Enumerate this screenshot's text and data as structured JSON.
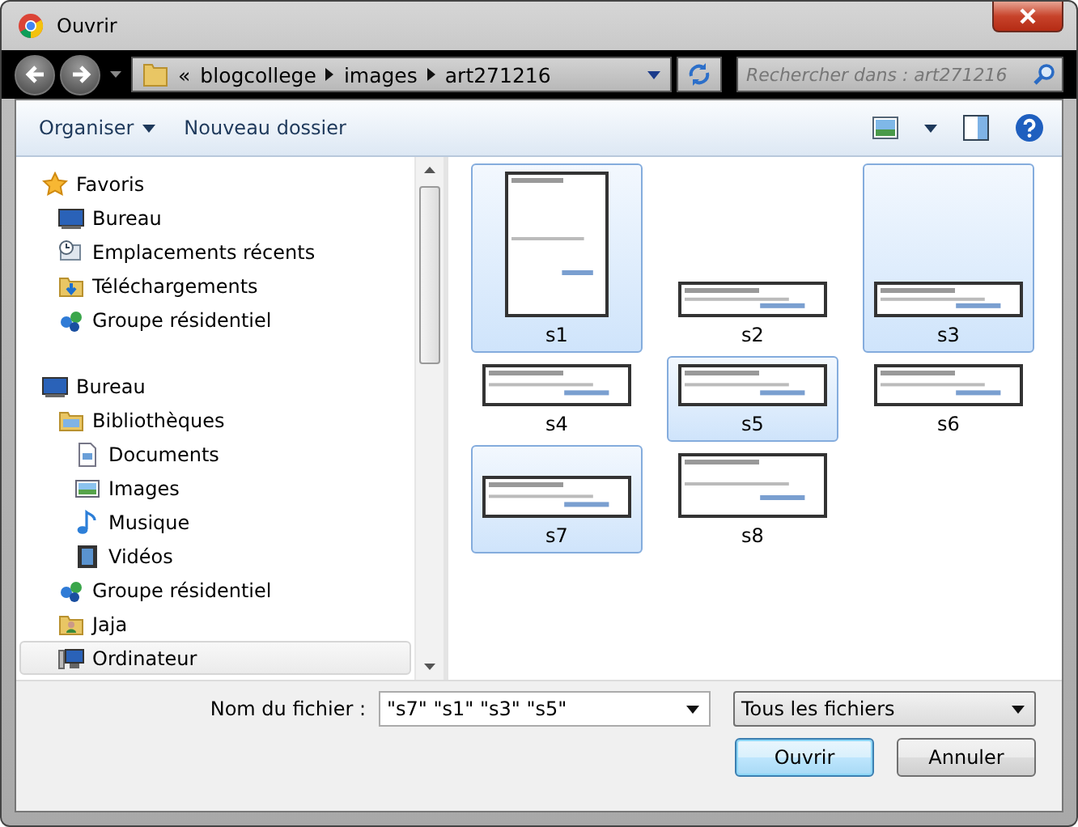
{
  "window": {
    "title": "Ouvrir"
  },
  "address": {
    "prefix": "«",
    "path": [
      "blogcollege",
      "images",
      "art271216"
    ]
  },
  "search": {
    "placeholder": "Rechercher dans : art271216"
  },
  "toolbar": {
    "organize": "Organiser",
    "new_folder": "Nouveau dossier"
  },
  "sidebar": {
    "groups": [
      {
        "label": "Favoris",
        "kind": "star",
        "selected": false,
        "children": [
          {
            "label": "Bureau",
            "kind": "desktop",
            "selected": false
          },
          {
            "label": "Emplacements récents",
            "kind": "recent",
            "selected": false
          },
          {
            "label": "Téléchargements",
            "kind": "download",
            "selected": false
          },
          {
            "label": "Groupe résidentiel",
            "kind": "homegroup",
            "selected": false
          }
        ]
      },
      {
        "label": "Bureau",
        "kind": "desktop",
        "selected": false,
        "children": [
          {
            "label": "Bibliothèques",
            "kind": "library",
            "selected": false,
            "children": [
              {
                "label": "Documents",
                "kind": "documents",
                "selected": false
              },
              {
                "label": "Images",
                "kind": "images",
                "selected": false
              },
              {
                "label": "Musique",
                "kind": "music",
                "selected": false
              },
              {
                "label": "Vidéos",
                "kind": "video",
                "selected": false
              }
            ]
          },
          {
            "label": "Groupe résidentiel",
            "kind": "homegroup",
            "selected": false
          },
          {
            "label": "Jaja",
            "kind": "user",
            "selected": false
          },
          {
            "label": "Ordinateur",
            "kind": "computer",
            "selected": true
          }
        ]
      }
    ]
  },
  "files": [
    {
      "name": "s1",
      "kind": "portrait",
      "selected": true
    },
    {
      "name": "s2",
      "kind": "banner",
      "selected": false
    },
    {
      "name": "s3",
      "kind": "banner",
      "selected": true
    },
    {
      "name": "s4",
      "kind": "landscape",
      "selected": false
    },
    {
      "name": "s5",
      "kind": "landscape",
      "selected": true
    },
    {
      "name": "s6",
      "kind": "landscape",
      "selected": false
    },
    {
      "name": "s7",
      "kind": "landscape",
      "selected": true
    },
    {
      "name": "s8",
      "kind": "box",
      "selected": false
    }
  ],
  "footer": {
    "filename_label": "Nom du fichier :",
    "filename": "\"s7\" \"s1\" \"s3\" \"s5\"",
    "filter": "Tous les fichiers",
    "buttons": [
      {
        "label": "Ouvrir",
        "kind": "default"
      },
      {
        "label": "Annuler",
        "kind": "normal"
      }
    ]
  }
}
